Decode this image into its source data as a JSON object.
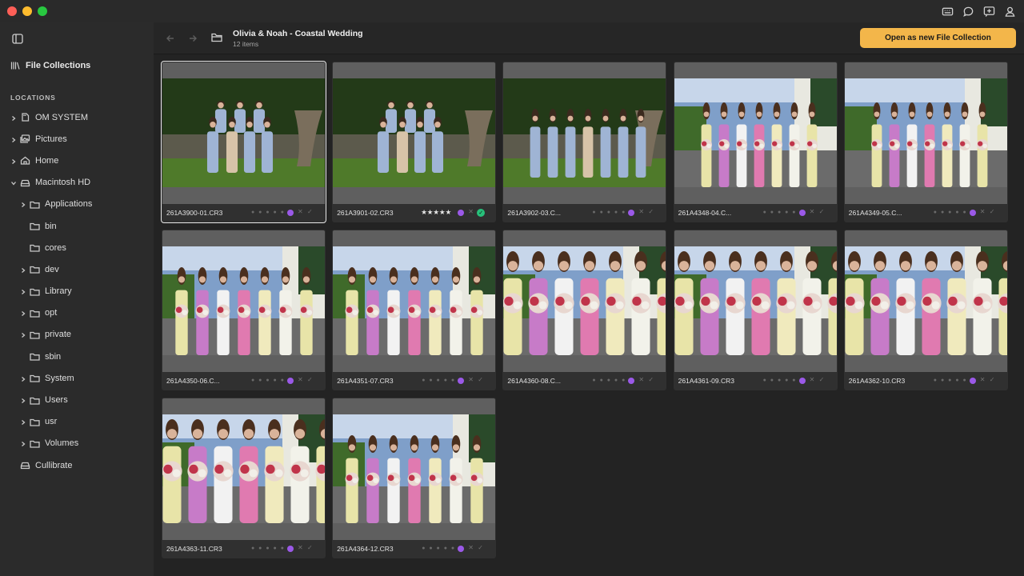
{
  "window": {
    "top_icons": [
      "keyboard-icon",
      "chat-icon",
      "add-comment-icon",
      "user-icon"
    ]
  },
  "sidebar": {
    "file_collections_label": "File Collections",
    "locations_title": "LOCATIONS",
    "items": [
      {
        "label": "OM SYSTEM",
        "level": 0,
        "icon": "sd-card-icon",
        "chevron": "right"
      },
      {
        "label": "Pictures",
        "level": 0,
        "icon": "pictures-icon",
        "chevron": "right"
      },
      {
        "label": "Home",
        "level": 0,
        "icon": "home-icon",
        "chevron": "right"
      },
      {
        "label": "Macintosh HD",
        "level": 0,
        "icon": "drive-icon",
        "chevron": "down"
      },
      {
        "label": "Applications",
        "level": 1,
        "icon": "folder-icon",
        "chevron": "right"
      },
      {
        "label": "bin",
        "level": 1,
        "icon": "folder-icon",
        "chevron": "none"
      },
      {
        "label": "cores",
        "level": 1,
        "icon": "folder-icon",
        "chevron": "none"
      },
      {
        "label": "dev",
        "level": 1,
        "icon": "folder-icon",
        "chevron": "right"
      },
      {
        "label": "Library",
        "level": 1,
        "icon": "folder-icon",
        "chevron": "right"
      },
      {
        "label": "opt",
        "level": 1,
        "icon": "folder-icon",
        "chevron": "right"
      },
      {
        "label": "private",
        "level": 1,
        "icon": "folder-icon",
        "chevron": "right"
      },
      {
        "label": "sbin",
        "level": 1,
        "icon": "folder-icon",
        "chevron": "none"
      },
      {
        "label": "System",
        "level": 1,
        "icon": "folder-icon",
        "chevron": "right"
      },
      {
        "label": "Users",
        "level": 1,
        "icon": "folder-icon",
        "chevron": "right"
      },
      {
        "label": "usr",
        "level": 1,
        "icon": "folder-icon",
        "chevron": "right"
      },
      {
        "label": "Volumes",
        "level": 1,
        "icon": "folder-icon",
        "chevron": "right"
      },
      {
        "label": "Cullibrate",
        "level": 0,
        "icon": "drive-icon",
        "chevron": "none"
      }
    ]
  },
  "toolbar": {
    "title": "Olivia & Noah - Coastal Wedding",
    "count": "12 items",
    "open_button": "Open as new File Collection"
  },
  "files": [
    {
      "name": "261A3900-01.CR3",
      "rating": 0,
      "label": "purple",
      "pick": false,
      "selected": true,
      "scene": "groom"
    },
    {
      "name": "261A3901-02.CR3",
      "rating": 5,
      "label": "purple",
      "pick": true,
      "selected": false,
      "scene": "groom"
    },
    {
      "name": "261A3902-03.C...",
      "rating": 0,
      "label": "purple",
      "pick": false,
      "selected": false,
      "scene": "groom-standing"
    },
    {
      "name": "261A4348-04.C...",
      "rating": 0,
      "label": "purple",
      "pick": false,
      "selected": false,
      "scene": "brides-wide"
    },
    {
      "name": "261A4349-05.C...",
      "rating": 0,
      "label": "purple",
      "pick": false,
      "selected": false,
      "scene": "brides-wide"
    },
    {
      "name": "261A4350-06.C...",
      "rating": 0,
      "label": "purple",
      "pick": false,
      "selected": false,
      "scene": "brides-mid"
    },
    {
      "name": "261A4351-07.CR3",
      "rating": 0,
      "label": "purple",
      "pick": false,
      "selected": false,
      "scene": "brides-mid"
    },
    {
      "name": "261A4360-08.C...",
      "rating": 0,
      "label": "purple",
      "pick": false,
      "selected": false,
      "scene": "brides-close"
    },
    {
      "name": "261A4361-09.CR3",
      "rating": 0,
      "label": "purple",
      "pick": false,
      "selected": false,
      "scene": "brides-close"
    },
    {
      "name": "261A4362-10.CR3",
      "rating": 0,
      "label": "purple",
      "pick": false,
      "selected": false,
      "scene": "brides-close"
    },
    {
      "name": "261A4363-11.CR3",
      "rating": 0,
      "label": "purple",
      "pick": false,
      "selected": false,
      "scene": "brides-close"
    },
    {
      "name": "261A4364-12.CR3",
      "rating": 0,
      "label": "purple",
      "pick": false,
      "selected": false,
      "scene": "brides-mid"
    }
  ],
  "glyphs": {
    "star_full": "★★★★★",
    "dots": "● ● ● ● ●",
    "reject": "✕",
    "pick": "✓"
  },
  "colors": {
    "accent": "#f3b64a",
    "label_purple": "#9b59e8",
    "pick_green": "#27c07a"
  }
}
